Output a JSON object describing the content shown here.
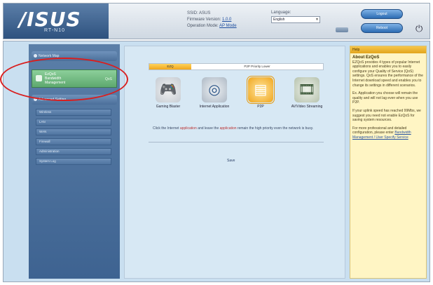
{
  "header": {
    "logo": "/ISUS",
    "model": "RT-N10",
    "ssid_label": "SSID:",
    "ssid_value": "ASUS",
    "firmware_label": "Firmware Version:",
    "firmware_value": "1.0.0",
    "opmode_label": "Operation Mode:",
    "opmode_value": "AP Mode",
    "language_label": "Language:",
    "language_value": "English",
    "logout_label": "Logout",
    "reboot_label": "Reboot"
  },
  "sidebar": {
    "top_item": "Network Map",
    "selected": {
      "line1": "EzQoS",
      "line2": "Bandwidth",
      "line3": "Management",
      "tag": "QoS"
    },
    "section": "Advanced Setting",
    "items": [
      "Wireless",
      "LAN",
      "WAN",
      "Firewall",
      "Administration",
      "System Log"
    ]
  },
  "content": {
    "tab_active": "EZQ",
    "tab_other": "P2P Priority Lower",
    "apps": [
      {
        "label": "Gaming Blaster",
        "icon": "gamepad-icon"
      },
      {
        "label": "Internet Application",
        "icon": "globe-icon"
      },
      {
        "label": "P2P",
        "icon": "p2p-folder-icon"
      },
      {
        "label": "AV/Video Streaming",
        "icon": "film-icon"
      }
    ],
    "desc_pre": "Click the Internet ",
    "desc_hl1": "application",
    "desc_mid": " and leave the ",
    "desc_hl2": "application",
    "desc_post": " remain the high priority even the network is busy.",
    "save_label": "Save"
  },
  "help": {
    "bar": "Help",
    "title": "About EzQoS",
    "p1": "EZQoS provides 4 types of popular Internet applications and enables you to easily configure your Quality of Service (QoS) settings. QoS ensures the performance of the Internet download speed and enables you to change its settings in different scenarios.",
    "p2": "Ex. Application you choose will remain the quality and will not lag even when you use P2P.",
    "p3": "If your uplink speed has reached 99Mbs, we suggest you need not enable EzQoS for saving system resources.",
    "p4_pre": "For more professional and detailed configuration, please enter ",
    "p4_link": "Bandwidth Management / User Specify Service"
  },
  "colors": {
    "annotation": "#d91e1e",
    "tab_active": "#f0a61c",
    "sidebar_selected": "#5ea96f",
    "help_bg": "#fff5c4"
  }
}
